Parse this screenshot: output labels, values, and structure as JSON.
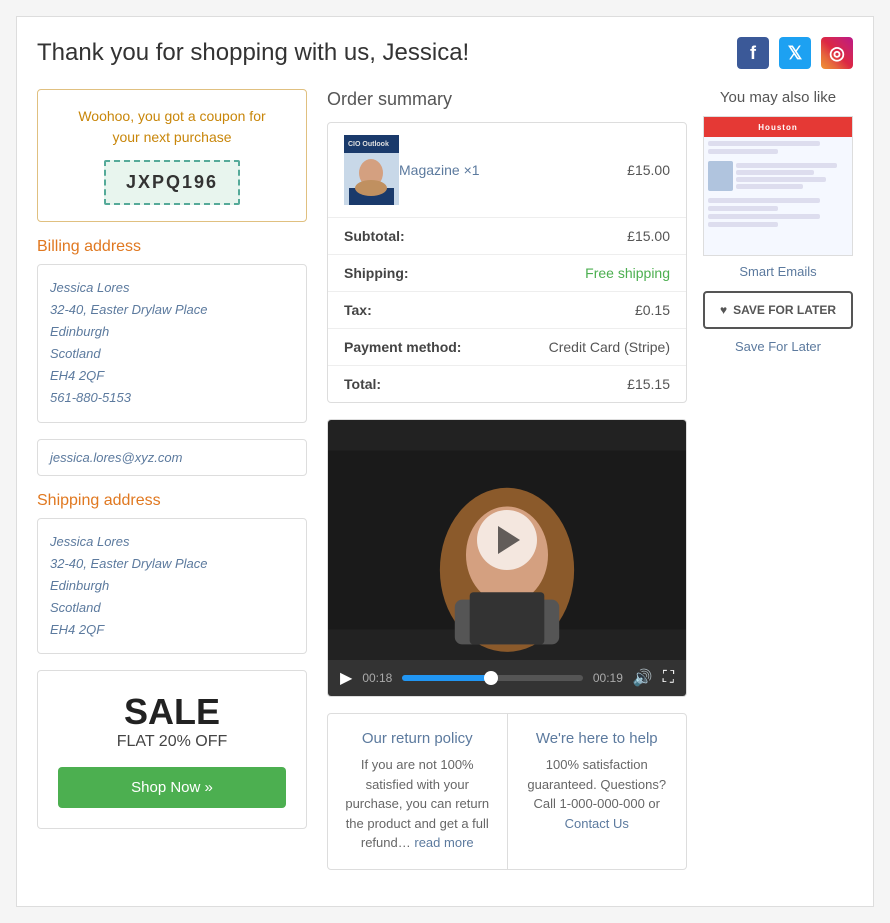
{
  "header": {
    "title": "Thank you for shopping with us, Jessica!",
    "social": {
      "facebook_label": "f",
      "twitter_label": "🐦",
      "instagram_label": "📷"
    }
  },
  "coupon": {
    "text_line1": "Woohoo, you got a coupon for",
    "text_line2": "your next purchase",
    "code": "JXPQ196"
  },
  "billing": {
    "title": "Billing address",
    "name": "Jessica Lores",
    "address1": "32-40, Easter Drylaw Place",
    "city": "Edinburgh",
    "region": "Scotland",
    "postcode": "EH4 2QF",
    "phone": "561-880-5153",
    "email": "jessica.lores@xyz.com"
  },
  "shipping": {
    "title": "Shipping address",
    "name": "Jessica Lores",
    "address1": "32-40, Easter Drylaw Place",
    "city": "Edinburgh",
    "region": "Scotland",
    "postcode": "EH4 2QF"
  },
  "sale": {
    "title": "SALE",
    "subtitle": "FLAT 20% OFF",
    "button_label": "Shop Now »"
  },
  "order_summary": {
    "title": "Order summary",
    "item": {
      "name": "Magazine",
      "quantity": "×1",
      "price": "£15.00"
    },
    "subtotal_label": "Subtotal:",
    "subtotal_value": "£15.00",
    "shipping_label": "Shipping:",
    "shipping_value": "Free shipping",
    "tax_label": "Tax:",
    "tax_value": "£0.15",
    "payment_label": "Payment method:",
    "payment_value": "Credit Card (Stripe)",
    "total_label": "Total:",
    "total_value": "£15.15"
  },
  "video": {
    "time_start": "00:18",
    "time_end": "00:19"
  },
  "policy": {
    "return_title": "Our return policy",
    "return_text": "If you are not 100% satisfied with your purchase, you can return the product and get a full refund…",
    "return_link": "read more",
    "help_title": "We're here to help",
    "help_text": "100% satisfaction guaranteed. Questions? Call 1-000-000-000 or",
    "help_link": "Contact Us"
  },
  "also_like": {
    "title": "You may also like",
    "product_label": "Smart Emails",
    "img_brand": "Houston",
    "save_button_label": "SAVE FOR LATER",
    "save_label": "Save For Later"
  }
}
